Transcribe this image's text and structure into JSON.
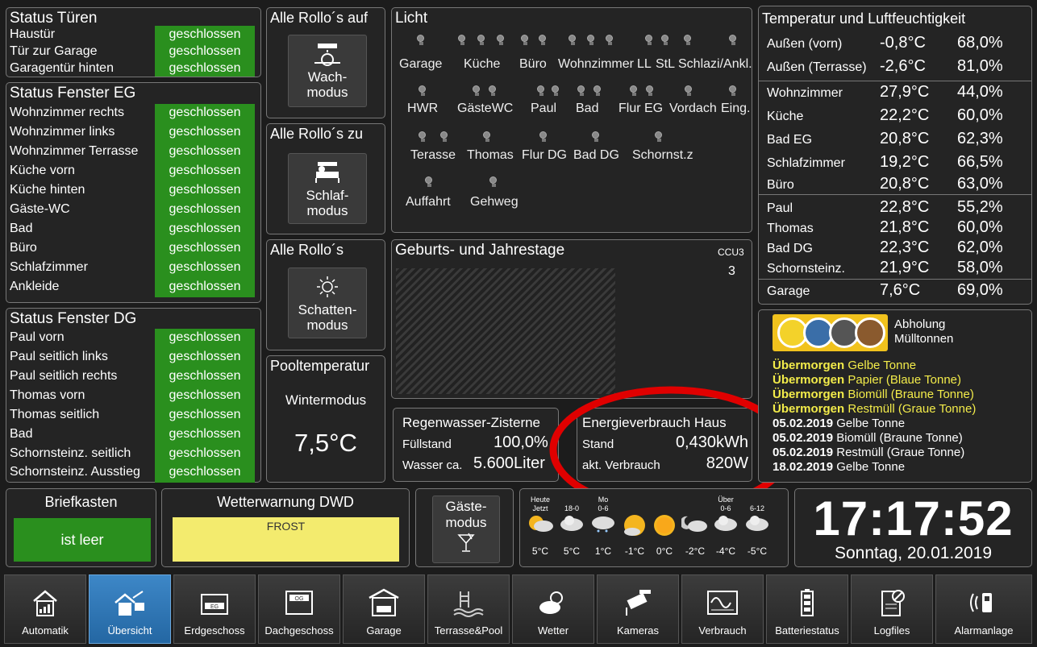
{
  "tueren": {
    "title": "Status Türen",
    "rows": [
      {
        "label": "Haustür",
        "value": "geschlossen"
      },
      {
        "label": "Tür zur Garage",
        "value": "geschlossen"
      },
      {
        "label": "Garagentür hinten",
        "value": "geschlossen"
      }
    ]
  },
  "fenster_eg": {
    "title": "Status Fenster EG",
    "rows": [
      {
        "label": "Wohnzimmer rechts",
        "value": "geschlossen"
      },
      {
        "label": "Wohnzimmer links",
        "value": "geschlossen"
      },
      {
        "label": "Wohnzimmer Terrasse",
        "value": "geschlossen"
      },
      {
        "label": "Küche vorn",
        "value": "geschlossen"
      },
      {
        "label": "Küche hinten",
        "value": "geschlossen"
      },
      {
        "label": "Gäste-WC",
        "value": "geschlossen"
      },
      {
        "label": "Bad",
        "value": "geschlossen"
      },
      {
        "label": "Büro",
        "value": "geschlossen"
      },
      {
        "label": "Schlafzimmer",
        "value": "geschlossen"
      },
      {
        "label": "Ankleide",
        "value": "geschlossen"
      }
    ]
  },
  "fenster_dg": {
    "title": "Status Fenster DG",
    "rows": [
      {
        "label": "Paul vorn",
        "value": "geschlossen"
      },
      {
        "label": "Paul seitlich links",
        "value": "geschlossen"
      },
      {
        "label": "Paul seitlich rechts",
        "value": "geschlossen"
      },
      {
        "label": "Thomas vorn",
        "value": "geschlossen"
      },
      {
        "label": "Thomas seitlich",
        "value": "geschlossen"
      },
      {
        "label": "Bad",
        "value": "geschlossen"
      },
      {
        "label": "Schornsteinz. seitlich",
        "value": "geschlossen"
      },
      {
        "label": "Schornsteinz. Ausstieg",
        "value": "geschlossen"
      }
    ]
  },
  "rollo_auf": {
    "title": "Alle Rollo´s auf",
    "line1": "Wach-",
    "line2": "modus"
  },
  "rollo_zu": {
    "title": "Alle Rollo´s zu",
    "line1": "Schlaf-",
    "line2": "modus"
  },
  "rollo": {
    "title": "Alle Rollo´s",
    "line1": "Schatten-",
    "line2": "modus"
  },
  "pool": {
    "title": "Pooltemperatur",
    "mode": "Wintermodus",
    "temp": "7,5°C"
  },
  "licht": {
    "title": "Licht",
    "labels": [
      "Garage",
      "Küche",
      "Büro",
      "Wohnzimmer",
      "LL",
      "StL",
      "Schlazi/Ankl.",
      "HWR",
      "GästeWC",
      "Paul",
      "Bad",
      "Flur EG",
      "Vordach",
      "Eing.",
      "Terasse",
      "Thomas",
      "Flur DG",
      "Bad DG",
      "Schornst.z",
      "Auffahrt",
      "Gehweg"
    ]
  },
  "geburtstage": {
    "title": "Geburts- und Jahrestage",
    "ccu_label": "CCU3",
    "ccu_value": "3"
  },
  "regen": {
    "title": "Regenwasser-Zisterne",
    "fill_label": "Füllstand",
    "fill_value": "100,0%",
    "water_label": "Wasser ca.",
    "water_value": "5.600Liter"
  },
  "energie": {
    "title": "Energieverbrauch Haus",
    "stand_label": "Stand",
    "stand_value": "0,430kWh",
    "verbrauch_label": "akt. Verbrauch",
    "verbrauch_value": "820W"
  },
  "temperatur": {
    "title": "Temperatur und Luftfeuchtigkeit",
    "groups": [
      [
        {
          "name": "Außen (vorn)",
          "temp": "-0,8°C",
          "hum": "68,0%"
        },
        {
          "name": "Außen (Terrasse)",
          "temp": "-2,6°C",
          "hum": "81,0%"
        }
      ],
      [
        {
          "name": "Wohnzimmer",
          "temp": "27,9°C",
          "hum": "44,0%"
        },
        {
          "name": "Küche",
          "temp": "22,2°C",
          "hum": "60,0%"
        },
        {
          "name": "Bad EG",
          "temp": "20,8°C",
          "hum": "62,3%"
        },
        {
          "name": "Schlafzimmer",
          "temp": "19,2°C",
          "hum": "66,5%"
        },
        {
          "name": "Büro",
          "temp": "20,8°C",
          "hum": "63,0%"
        }
      ],
      [
        {
          "name": "Paul",
          "temp": "22,8°C",
          "hum": "55,2%"
        },
        {
          "name": "Thomas",
          "temp": "21,8°C",
          "hum": "60,0%"
        },
        {
          "name": "Bad DG",
          "temp": "22,3°C",
          "hum": "62,0%"
        },
        {
          "name": "Schornsteinz.",
          "temp": "21,9°C",
          "hum": "58,0%"
        }
      ],
      [
        {
          "name": "Garage",
          "temp": "7,6°C",
          "hum": "69,0%"
        }
      ]
    ]
  },
  "muell": {
    "title_line1": "Abholung",
    "title_line2": "Mülltonnen",
    "entries": [
      {
        "bold": "Übermorgen",
        "text": " Gelbe Tonne",
        "highlight": true
      },
      {
        "bold": "Übermorgen",
        "text": " Papier (Blaue Tonne)",
        "highlight": true
      },
      {
        "bold": "Übermorgen",
        "text": " Biomüll (Braune Tonne)",
        "highlight": true
      },
      {
        "bold": "Übermorgen",
        "text": " Restmüll (Graue Tonne)",
        "highlight": true
      },
      {
        "bold": "05.02.2019",
        "text": " Gelbe Tonne",
        "highlight": false
      },
      {
        "bold": "05.02.2019",
        "text": " Biomüll (Braune Tonne)",
        "highlight": false
      },
      {
        "bold": "05.02.2019",
        "text": " Restmüll (Graue Tonne)",
        "highlight": false
      },
      {
        "bold": "18.02.2019",
        "text": " Gelbe Tonne",
        "highlight": false
      }
    ]
  },
  "briefkasten": {
    "title": "Briefkasten",
    "status": "ist leer"
  },
  "wetterwarnung": {
    "title": "Wetterwarnung DWD",
    "text": "FROST"
  },
  "gaeste": {
    "line1": "Gäste-",
    "line2": "modus"
  },
  "wetter": {
    "columns": [
      {
        "top1": "Heute",
        "top2": "Jetzt",
        "temp": "5°C"
      },
      {
        "top1": "",
        "top2": "18-0",
        "temp": "5°C"
      },
      {
        "top1": "Mo",
        "top2": "0-6",
        "temp": "1°C"
      },
      {
        "top1": "",
        "top2": "",
        "temp": "-1°C"
      },
      {
        "top1": "",
        "top2": "",
        "temp": "0°C"
      },
      {
        "top1": "",
        "top2": "",
        "temp": "-2°C"
      },
      {
        "top1": "Über",
        "top2": "0-6",
        "temp": "-4°C"
      },
      {
        "top1": "",
        "top2": "6-12",
        "temp": "-5°C"
      }
    ]
  },
  "clock": {
    "time": "17:17:52",
    "date": "Sonntag, 20.01.2019"
  },
  "nav": [
    {
      "label": "Automatik",
      "icon": "house-auto-icon"
    },
    {
      "label": "Übersicht",
      "icon": "house-overview-icon"
    },
    {
      "label": "Erdgeschoss",
      "icon": "floor-eg-icon"
    },
    {
      "label": "Dachgeschoss",
      "icon": "floor-og-icon"
    },
    {
      "label": "Garage",
      "icon": "garage-icon"
    },
    {
      "label": "Terrasse&Pool",
      "icon": "pool-icon"
    },
    {
      "label": "Wetter",
      "icon": "weather-icon"
    },
    {
      "label": "Kameras",
      "icon": "camera-icon"
    },
    {
      "label": "Verbrauch",
      "icon": "meter-icon"
    },
    {
      "label": "Batteriestatus",
      "icon": "battery-icon"
    },
    {
      "label": "Logfiles",
      "icon": "logfile-icon"
    },
    {
      "label": "Alarmanlage",
      "icon": "alarm-icon"
    }
  ],
  "colors": {
    "status_green": "#2a8f1e",
    "warning_yellow": "#f3eb6e",
    "muell_yellow": "#f3ec4a",
    "active_blue": "#2f78b8",
    "annotation_red": "#e00000"
  }
}
